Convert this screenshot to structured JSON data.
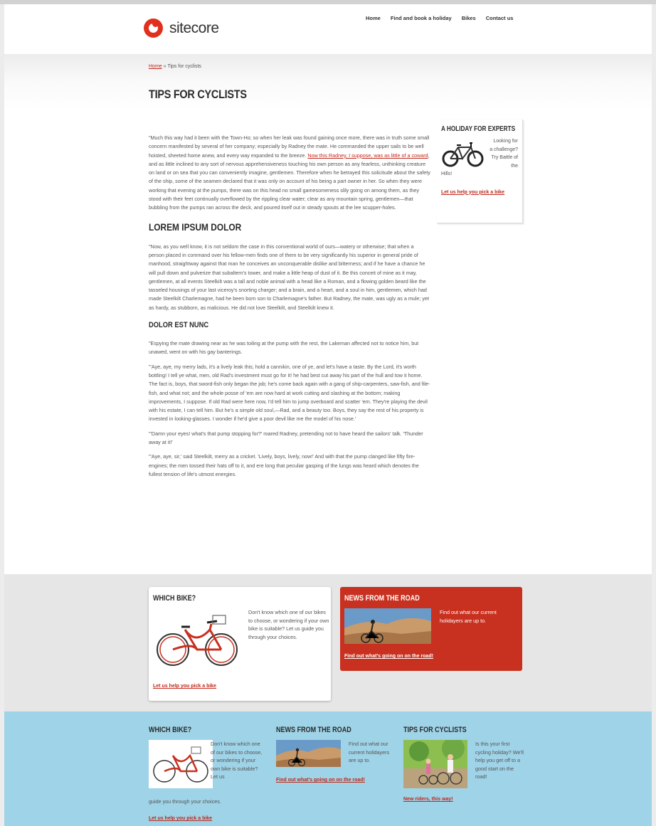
{
  "header": {
    "logo_text": "sitecore",
    "nav": [
      "Home",
      "Find and book a holiday",
      "Bikes",
      "Contact us"
    ]
  },
  "breadcrumb": {
    "home": "Home",
    "separator": " » ",
    "current": "Tips for cyclists"
  },
  "page": {
    "title": "TIPS FOR CYCLISTS",
    "para1_a": "\"Much this way had it been with the Town-Ho; so when her leak was found gaining once more, there was in truth some small concern manifested by several of her company; especially by Radney the mate. He commanded the upper sails to be well hoisted, sheeted home anew, and every way expanded to the breeze. ",
    "para1_link": "Now this Radney, I suppose, was as little of a coward",
    "para1_b": ", and as little inclined to any sort of nervous apprehensiveness touching his own person as any fearless, unthinking creature on land or on sea that you can conveniently imagine, gentlemen. Therefore when he betrayed this solicitude about the safety of the ship, some of the seamen declared that it was only on account of his being a part owner in her. So when they were working that evening at the pumps, there was on this head no small gamesomeness slily going on among them, as they stood with their feet continually overflowed by the rippling clear water; clear as any mountain spring, gentlemen—that bubbling from the pumps ran across the deck, and poured itself out in steady spouts at the lee scupper-holes.",
    "heading2": "LOREM IPSUM DOLOR",
    "para2": "\"Now, as you well know, it is not seldom the case in this conventional world of ours—watery or otherwise; that when a person placed in command over his fellow-men finds one of them to be very significantly his superior in general pride of manhood, straightway against that man he conceives an unconquerable dislike and bitterness; and if he have a chance he will pull down and pulverize that subaltern's tower, and make a little heap of dust of it. Be this conceit of mine as it may, gentlemen, at all events Steelkilt was a tall and noble animal with a head like a Roman, and a flowing golden beard like the tasseled housings of your last viceroy's snorting charger; and a brain, and a heart, and a soul in him, gentlemen, which had made Steelkilt Charlemagne, had he been born son to Charlemagne's father. But Radney, the mate, was ugly as a mule; yet as hardy, as stubborn, as malicious. He did not love Steelkilt, and Steelkilt knew it.",
    "heading3": "DOLOR EST NUNC",
    "para3": "\"Espying the mate drawing near as he was toiling at the pump with the rest, the Lakeman affected not to notice him, but unawed, went on with his gay banterings.",
    "para4": "\"'Aye, aye, my merry lads, it's a lively leak this; hold a cannikin, one of ye, and let's have a taste. By the Lord, it's worth bottling! I tell ye what, men, old Rad's investment must go for it! he had best cut away his part of the hull and tow it home. The fact is, boys, that sword-fish only began the job; he's come back again with a gang of ship-carpenters, saw-fish, and file-fish, and what not; and the whole posse of 'em are now hard at work cutting and slashing at the bottom; making improvements, I suppose. If old Rad were here now, I'd tell him to jump overboard and scatter 'em. They're playing the devil with his estate, I can tell him. But he's a simple old soul,—Rad, and a beauty too. Boys, they say the rest of his property is invested in looking-glasses. I wonder if he'd give a poor devil like me the model of his nose.'",
    "para5": "\"'Damn your eyes! what's that pump stopping for?' roared Radney, pretending not to have heard the sailors' talk. 'Thunder away at it!'",
    "para6": "\"'Aye, aye, sir,' said Steelkilt, merry as a cricket. 'Lively, boys, lively, now!' And with that the pump clanged like fifty fire-engines; the men tossed their hats off to it, and ere long that peculiar gasping of the lungs was heard which denotes the fullest tension of life's utmost energies."
  },
  "sidebox": {
    "title": "A HOLIDAY FOR EXPERTS",
    "text_a": "Looking for a challenge? Try Battle of the",
    "text_b": "Hills!",
    "link": "Let us help you pick a bike"
  },
  "promo": {
    "which_bike": {
      "title": "WHICH BIKE?",
      "text": "Don't know which one of our bikes to choose, or wondering if your own bike is suitable? Let us guide you through your choices.",
      "link": "Let us help you pick a bike"
    },
    "news": {
      "title": "NEWS FROM THE ROAD",
      "text": "Find out what our current holidayers are up to.",
      "link": "Find out what's going on on the road!"
    }
  },
  "footer": {
    "col1": {
      "title": "WHICH BIKE?",
      "text_a": "Don't know which one of our bikes to choose, or wondering if your own bike is suitable? Let us",
      "text_b": "guide you through your choices.",
      "link": "Let us help you pick a bike"
    },
    "col2": {
      "title": "NEWS FROM THE ROAD",
      "text": "Find out what our current holidayers are up to.",
      "link": "Find out what's going on on the road!"
    },
    "col3": {
      "title": "TIPS FOR CYCLISTS",
      "text": "Is this your first cycling holiday? We'll help you get off to a good start on the road!",
      "link": "New riders, this way!"
    }
  },
  "colors": {
    "brand_red": "#c8301f",
    "link_red": "#c0281a",
    "footer_blue": "#9fd3e7"
  }
}
